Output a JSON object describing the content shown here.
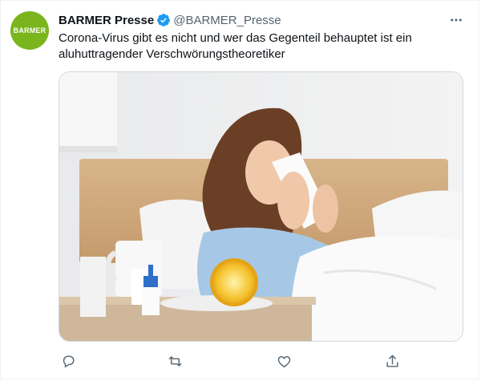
{
  "tweet": {
    "author": {
      "display_name": "BARMER Presse",
      "handle": "@BARMER_Presse",
      "avatar_text": "BARMER",
      "avatar_color": "#7ab51d",
      "verified": true
    },
    "text": "Corona-Virus gibt es nicht und wer das Gegenteil behauptet ist ein aluhuttragender Verschwörungstheoretiker",
    "media": {
      "type": "photo",
      "alt": "Frau mit Taschentuch im Bett"
    },
    "actions": [
      {
        "name": "reply",
        "icon": "reply-icon"
      },
      {
        "name": "retweet",
        "icon": "retweet-icon"
      },
      {
        "name": "like",
        "icon": "heart-icon"
      },
      {
        "name": "share",
        "icon": "share-icon"
      }
    ]
  },
  "colors": {
    "accent": "#1d9bf0",
    "text_primary": "#0f1419",
    "text_secondary": "#536471",
    "border": "#eff3f4"
  }
}
